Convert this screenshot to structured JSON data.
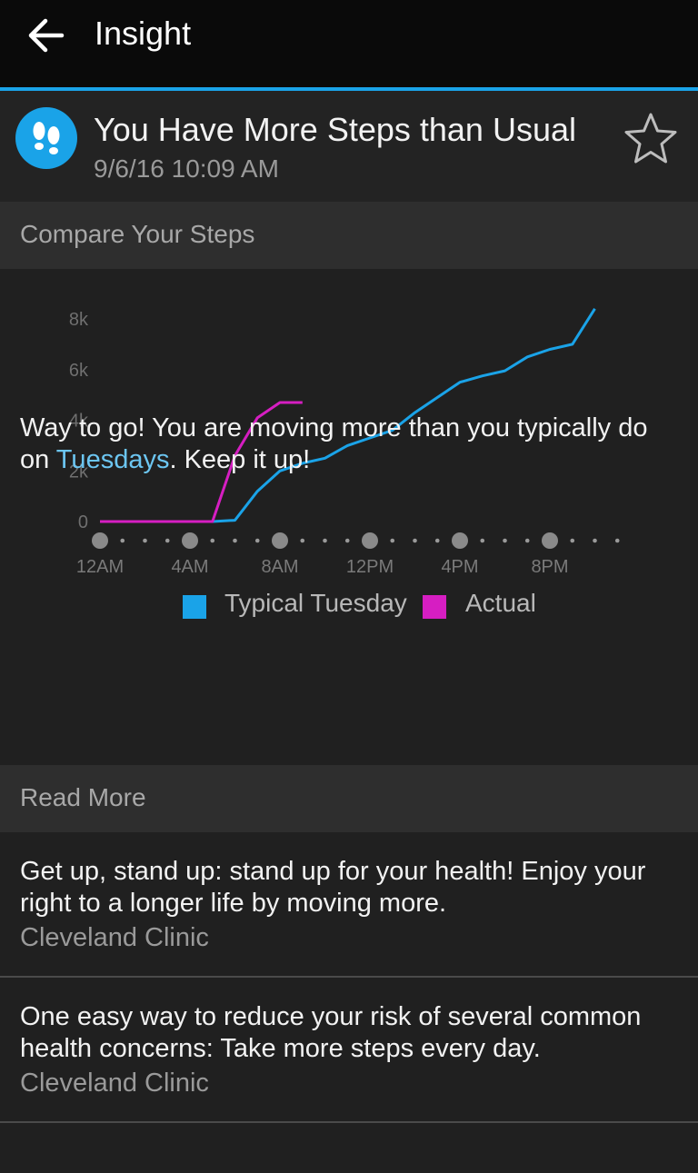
{
  "appbar": {
    "title": "Insight",
    "back_icon": "back-arrow-icon"
  },
  "header": {
    "title": "You Have More Steps than Usual",
    "date": "9/6/16 10:09 AM",
    "icon": "footsteps-icon",
    "favorite_icon": "star-outline-icon"
  },
  "compare_section": {
    "title": "Compare Your Steps"
  },
  "chart_data": {
    "type": "line",
    "x_tick_labels": [
      "12AM",
      "4AM",
      "8AM",
      "12PM",
      "4PM",
      "8PM"
    ],
    "y_tick_labels": [
      "0",
      "2k",
      "4k",
      "6k",
      "8k"
    ],
    "ylim": [
      0,
      8000
    ],
    "xlim": [
      0,
      23
    ],
    "grid": false,
    "legend_position": "bottom",
    "series": [
      {
        "name": "Typical Tuesday",
        "color": "#1aa3e8",
        "x": [
          5,
          6,
          7,
          8,
          9,
          10,
          11,
          12,
          13,
          14,
          15,
          16,
          17,
          18,
          19,
          20,
          21,
          22
        ],
        "y": [
          0,
          50,
          1200,
          2000,
          2300,
          2500,
          3000,
          3300,
          3600,
          4300,
          4900,
          5500,
          5750,
          5950,
          6500,
          6800,
          7000,
          8400
        ]
      },
      {
        "name": "Actual",
        "color": "#d61ec2",
        "x": [
          0,
          5,
          6,
          7,
          8,
          9
        ],
        "y": [
          0,
          0,
          2600,
          4100,
          4700,
          4700
        ]
      }
    ]
  },
  "message": {
    "before": "Way to go! You are moving more than you typically do on ",
    "highlight": "Tuesdays",
    "after": ". Keep it up!"
  },
  "read_more": {
    "title": "Read More",
    "articles": [
      {
        "text": "Get up, stand up: stand up for your health! Enjoy your right to a longer life by moving more.",
        "source": "Cleveland Clinic"
      },
      {
        "text": "One easy way to reduce your risk of several common health concerns: Take more steps every day.",
        "source": "Cleveland Clinic"
      }
    ]
  }
}
